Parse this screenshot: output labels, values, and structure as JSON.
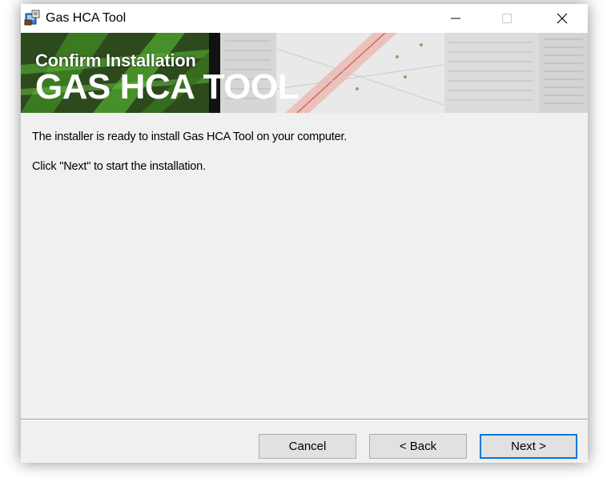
{
  "window": {
    "title": "Gas HCA Tool",
    "controls": {
      "minimize": "minimize",
      "maximize": "maximize",
      "close": "close"
    }
  },
  "banner": {
    "heading": "Confirm Installation",
    "product": "GAS HCA TOOL"
  },
  "content": {
    "line1": "The installer is ready to install Gas HCA Tool on your computer.",
    "line2": "Click \"Next\" to start the installation."
  },
  "buttons": {
    "cancel": "Cancel",
    "back": "< Back",
    "next": "Next >"
  },
  "colors": {
    "focus_border": "#0078d7",
    "banner_green": "#3f9a2a",
    "pipeline_red": "#c0392b"
  }
}
